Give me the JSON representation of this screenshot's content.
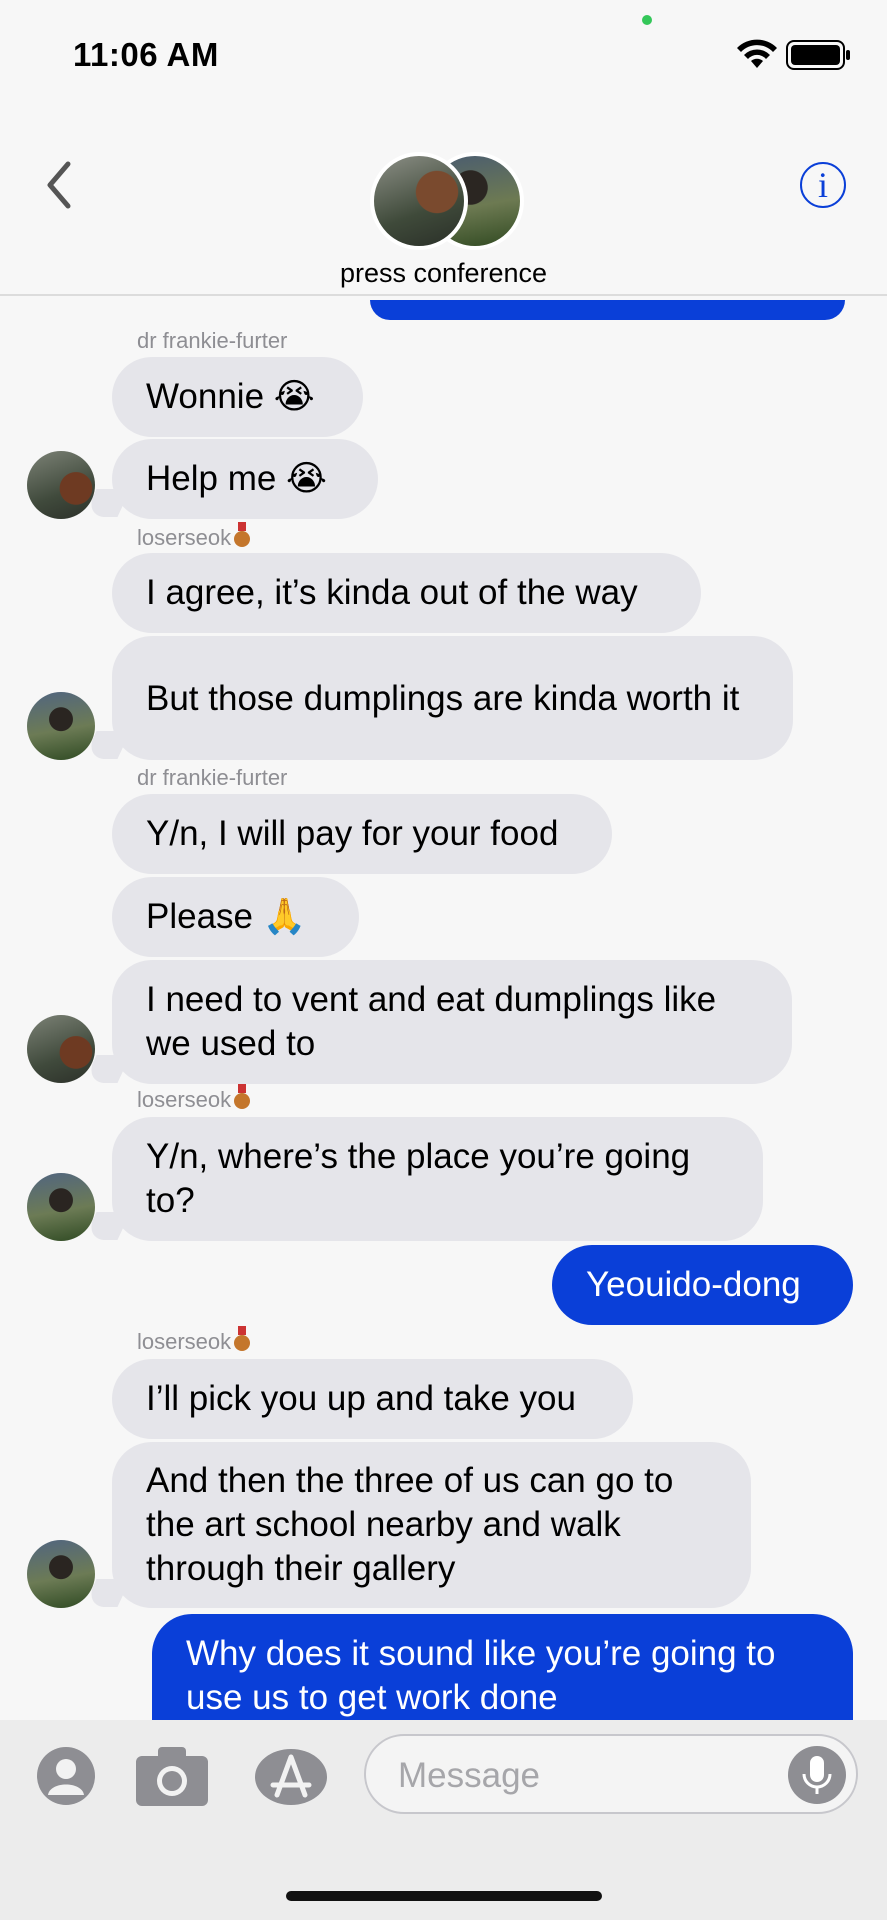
{
  "status": {
    "time": "11:06 AM"
  },
  "header": {
    "group_name": "press conference"
  },
  "input": {
    "placeholder": "Message"
  },
  "colors": {
    "accent": "#0a3fd8",
    "incoming_bubble": "#e5e5ea",
    "outgoing_bubble": "#0a3fd8",
    "mic_button": "#8e8e93"
  },
  "icons": [
    "back-chevron-icon",
    "info-icon",
    "contacts-icon",
    "camera-icon",
    "app-store-icon",
    "microphone-icon",
    "wifi-icon",
    "battery-icon"
  ],
  "messages": {
    "s1": "dr frankie-furter",
    "m1": "Wonnie 😭",
    "m2": "Help me 😭",
    "s2": "loserseok",
    "m3": "I agree, it’s kinda out of the way",
    "m4": "But those dumplings are kinda worth it",
    "s3": "dr frankie-furter",
    "m5": "Y/n, I will pay for your food",
    "m6": "Please 🙏",
    "m7": "I need to vent and eat dumplings like we used to",
    "s4": "loserseok",
    "m8": "Y/n, where’s the place you’re going to?",
    "m9": "Yeouido-dong",
    "s5": "loserseok",
    "m10": "I’ll pick you up and take you",
    "m11": "And then the three of us can go to the art school nearby and walk through their gallery",
    "m12": "Why does it sound like you’re going to use us to get work done"
  }
}
